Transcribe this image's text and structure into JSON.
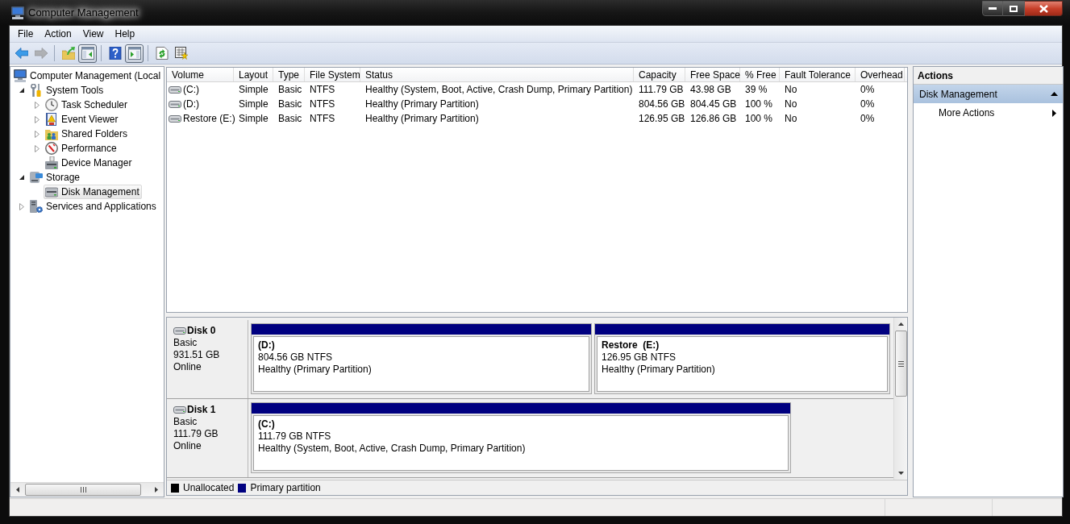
{
  "window": {
    "title": "Computer Management"
  },
  "menu": [
    {
      "label": "File"
    },
    {
      "label": "Action"
    },
    {
      "label": "View"
    },
    {
      "label": "Help"
    }
  ],
  "toolbar": [
    {
      "kind": "back",
      "disabled": false,
      "pressed": false
    },
    {
      "kind": "forward",
      "disabled": true,
      "pressed": false
    },
    {
      "kind": "separator"
    },
    {
      "kind": "up",
      "disabled": false,
      "pressed": false
    },
    {
      "kind": "console-tree",
      "disabled": false,
      "pressed": true
    },
    {
      "kind": "separator"
    },
    {
      "kind": "help",
      "disabled": false,
      "pressed": false
    },
    {
      "kind": "action-pane",
      "disabled": false,
      "pressed": true
    },
    {
      "kind": "separator"
    },
    {
      "kind": "refresh",
      "disabled": false,
      "pressed": false
    },
    {
      "kind": "export",
      "disabled": false,
      "pressed": false
    }
  ],
  "tree": [
    {
      "label": "Computer Management (Local",
      "kind": "computer",
      "selected": false,
      "children": [
        {
          "label": "System Tools",
          "kind": "tools",
          "expanded": true,
          "selected": false,
          "children": [
            {
              "label": "Task Scheduler",
              "kind": "clock",
              "expanded": false,
              "selected": false
            },
            {
              "label": "Event Viewer",
              "kind": "event-log",
              "expanded": false,
              "selected": false
            },
            {
              "label": "Shared Folders",
              "kind": "shared-folder",
              "expanded": false,
              "selected": false
            },
            {
              "label": "Performance",
              "kind": "gauge",
              "expanded": false,
              "selected": false
            },
            {
              "label": "Device Manager",
              "kind": "device",
              "selected": false
            }
          ]
        },
        {
          "label": "Storage",
          "kind": "storage",
          "expanded": true,
          "selected": false,
          "children": [
            {
              "label": "Disk Management",
              "kind": "disk",
              "selected": true
            }
          ]
        },
        {
          "label": "Services and Applications",
          "kind": "services",
          "expanded": false,
          "selected": false
        }
      ]
    }
  ],
  "volumes": {
    "columns": [
      "Volume",
      "Layout",
      "Type",
      "File System",
      "Status",
      "Capacity",
      "Free Space",
      "% Free",
      "Fault Tolerance",
      "Overhead"
    ],
    "rows": [
      {
        "selected": false,
        "cells": [
          "(C:)",
          "Simple",
          "Basic",
          "NTFS",
          "Healthy (System, Boot, Active, Crash Dump, Primary Partition)",
          "111.79 GB",
          "43.98 GB",
          "39 %",
          "No",
          "0%"
        ]
      },
      {
        "selected": false,
        "cells": [
          "(D:)",
          "Simple",
          "Basic",
          "NTFS",
          "Healthy (Primary Partition)",
          "804.56 GB",
          "804.45 GB",
          "100 %",
          "No",
          "0%"
        ]
      },
      {
        "selected": false,
        "cells": [
          "Restore (E:)",
          "Simple",
          "Basic",
          "NTFS",
          "Healthy (Primary Partition)",
          "126.95 GB",
          "126.86 GB",
          "100 %",
          "No",
          "0%"
        ]
      }
    ]
  },
  "disks": [
    {
      "name": "Disk 0",
      "type": "Basic",
      "size": "931.51 GB",
      "status": "Online",
      "partitions": [
        {
          "name": "(D:)",
          "kind": "primary",
          "size": "804.56 GB NTFS",
          "status": "Healthy (Primary Partition)"
        },
        {
          "name": "Restore  (E:)",
          "kind": "primary",
          "size": "126.95 GB NTFS",
          "status": "Healthy (Primary Partition)"
        }
      ]
    },
    {
      "name": "Disk 1",
      "type": "Basic",
      "size": "111.79 GB",
      "status": "Online",
      "partitions": [
        {
          "name": "(C:)",
          "kind": "primary",
          "size": "111.79 GB NTFS",
          "status": "Healthy (System, Boot, Active, Crash Dump, Primary Partition)"
        }
      ]
    }
  ],
  "legend": [
    {
      "label": "Unallocated",
      "color": "#000000"
    },
    {
      "label": "Primary partition",
      "color": "#000080"
    }
  ],
  "actions": {
    "title": "Actions",
    "sections": [
      {
        "label": "Disk Management",
        "expanded": true,
        "items": [
          {
            "label": "More Actions",
            "submenu": true
          }
        ]
      }
    ]
  }
}
